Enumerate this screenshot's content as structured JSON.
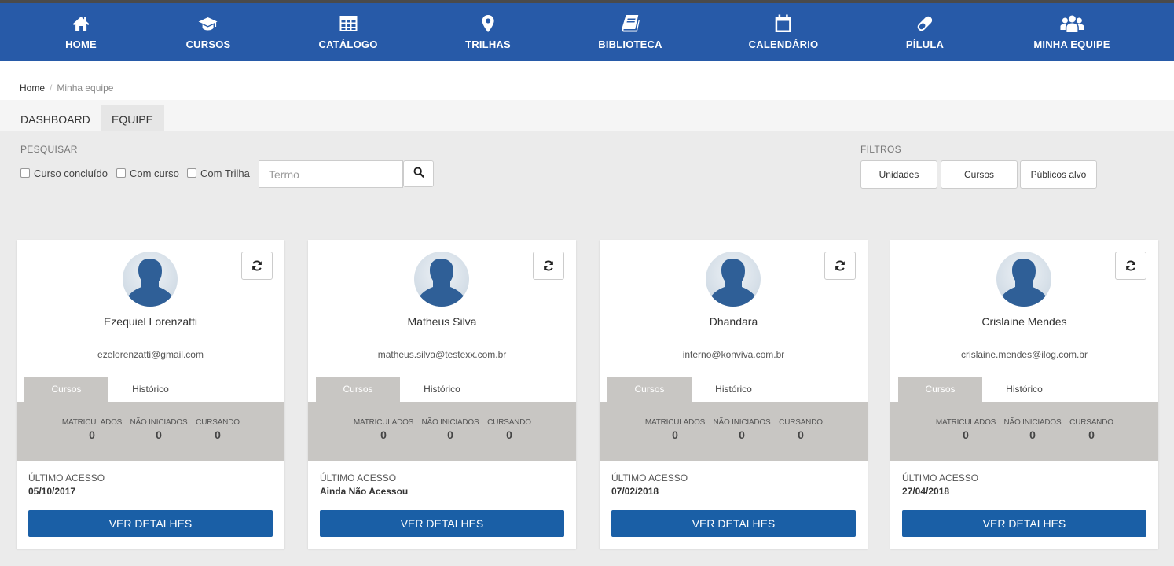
{
  "colors": {
    "nav_bg": "#275aa8",
    "primary_button": "#1a5fa6",
    "stats_bg": "#c8c6c3"
  },
  "nav": [
    {
      "label": "HOME",
      "icon": "home-icon"
    },
    {
      "label": "CURSOS",
      "icon": "graduation-cap-icon"
    },
    {
      "label": "CATÁLOGO",
      "icon": "table-icon"
    },
    {
      "label": "TRILHAS",
      "icon": "map-marker-icon"
    },
    {
      "label": "BIBLIOTECA",
      "icon": "book-icon"
    },
    {
      "label": "CALENDÁRIO",
      "icon": "calendar-icon"
    },
    {
      "label": "PÍLULA",
      "icon": "pill-icon"
    },
    {
      "label": "MINHA EQUIPE",
      "icon": "users-icon"
    }
  ],
  "breadcrumb": {
    "home": "Home",
    "separator": "/",
    "current": "Minha equipe"
  },
  "tabs": [
    {
      "label": "DASHBOARD"
    },
    {
      "label": "EQUIPE"
    }
  ],
  "search": {
    "section_label": "PESQUISAR",
    "checkboxes": [
      "Curso concluído",
      "Com curso",
      "Com Trilha"
    ],
    "placeholder": "Termo",
    "button_icon": "search-icon"
  },
  "filters": {
    "section_label": "FILTROS",
    "buttons": [
      "Unidades",
      "Cursos",
      "Públicos alvo"
    ]
  },
  "card_labels": {
    "tab_courses": "Cursos",
    "tab_history": "Histórico",
    "stat_enrolled": "MATRICULADOS",
    "stat_not_started": "NÃO INICIADOS",
    "stat_in_progress": "CURSANDO",
    "last_access": "ÚLTIMO ACESSO",
    "details_button": "VER DETALHES",
    "refresh_icon": "refresh-icon",
    "avatar_icon": "user-silhouette-icon"
  },
  "members": [
    {
      "name": "Ezequiel Lorenzatti",
      "email": "ezelorenzatti@gmail.com",
      "enrolled": "0",
      "not_started": "0",
      "in_progress": "0",
      "last_access": "05/10/2017"
    },
    {
      "name": "Matheus Silva",
      "email": "matheus.silva@testexx.com.br",
      "enrolled": "0",
      "not_started": "0",
      "in_progress": "0",
      "last_access": "Ainda Não Acessou"
    },
    {
      "name": "Dhandara",
      "email": "interno@konviva.com.br",
      "enrolled": "0",
      "not_started": "0",
      "in_progress": "0",
      "last_access": "07/02/2018"
    },
    {
      "name": "Crislaine Mendes",
      "email": "crislaine.mendes@ilog.com.br",
      "enrolled": "0",
      "not_started": "0",
      "in_progress": "0",
      "last_access": "27/04/2018"
    }
  ]
}
